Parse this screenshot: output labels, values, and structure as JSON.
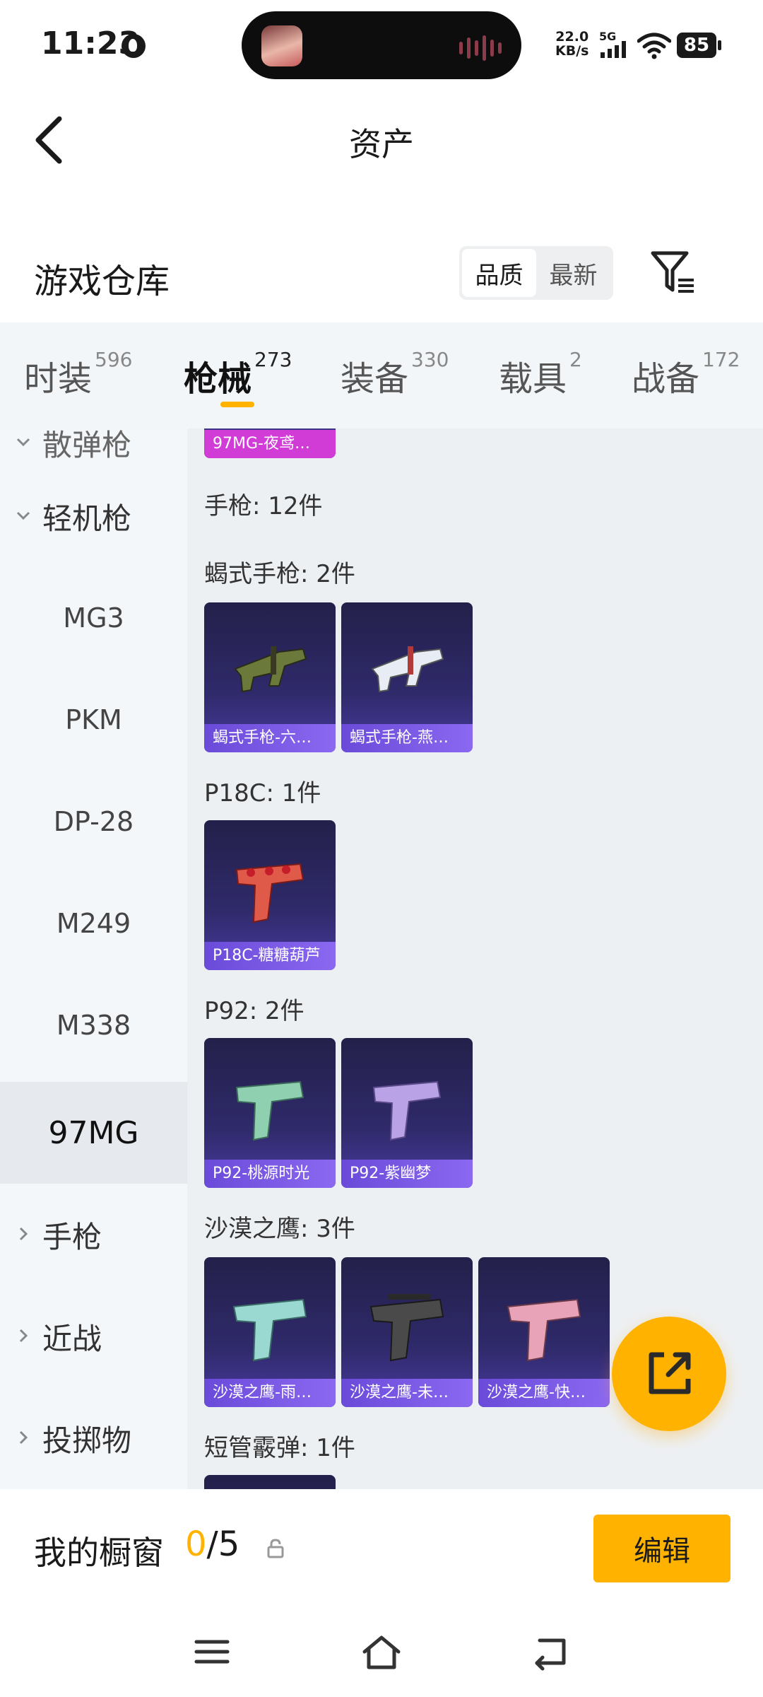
{
  "status_bar": {
    "time": "11:23",
    "net_speed_value": "22.0",
    "net_speed_unit": "KB/s",
    "network": "5G",
    "battery": "85"
  },
  "header": {
    "title": "资产"
  },
  "warehouse": {
    "title": "游戏仓库",
    "sort_options": [
      "品质",
      "最新"
    ],
    "active_sort": "品质"
  },
  "tabs": [
    {
      "label": "时装",
      "count": "596"
    },
    {
      "label": "枪械",
      "count": "273"
    },
    {
      "label": "装备",
      "count": "330"
    },
    {
      "label": "载具",
      "count": "2"
    },
    {
      "label": "战备",
      "count": "172"
    }
  ],
  "active_tab": "枪械",
  "sidebar": {
    "partial_top": "散弹枪",
    "groups": [
      {
        "label": "轻机枪",
        "expanded": true
      },
      {
        "label": "手枪",
        "expanded": false
      },
      {
        "label": "近战",
        "expanded": false
      },
      {
        "label": "投掷物",
        "expanded": false
      }
    ],
    "sub_items": [
      "MG3",
      "PKM",
      "DP-28",
      "M249",
      "M338",
      "97MG"
    ],
    "selected": "97MG"
  },
  "content": {
    "partial_card": "97MG-夜鸢…",
    "category_heading": "手枪: 12件",
    "sections": [
      {
        "heading": "蝎式手枪: 2件",
        "items": [
          "蝎式手枪-六…",
          "蝎式手枪-燕…"
        ]
      },
      {
        "heading": "P18C: 1件",
        "items": [
          "P18C-糖糖葫芦"
        ]
      },
      {
        "heading": "P92: 2件",
        "items": [
          "P92-桃源时光",
          "P92-紫幽梦"
        ]
      },
      {
        "heading": "沙漠之鹰: 3件",
        "items": [
          "沙漠之鹰-雨…",
          "沙漠之鹰-未…",
          "沙漠之鹰-快…"
        ]
      },
      {
        "heading": "短管霰弹: 1件",
        "items": []
      }
    ]
  },
  "showcase": {
    "label": "我的橱窗",
    "current": "0",
    "total": "/5",
    "edit_label": "编辑"
  },
  "colors": {
    "accent": "#ffb300",
    "card_bg": "#2f2a6a",
    "card_label": "#7a5ae6"
  },
  "icons": [
    "back-arrow-icon",
    "filter-icon",
    "share-icon",
    "lock-icon",
    "menu-icon",
    "home-icon",
    "back-nav-icon"
  ]
}
